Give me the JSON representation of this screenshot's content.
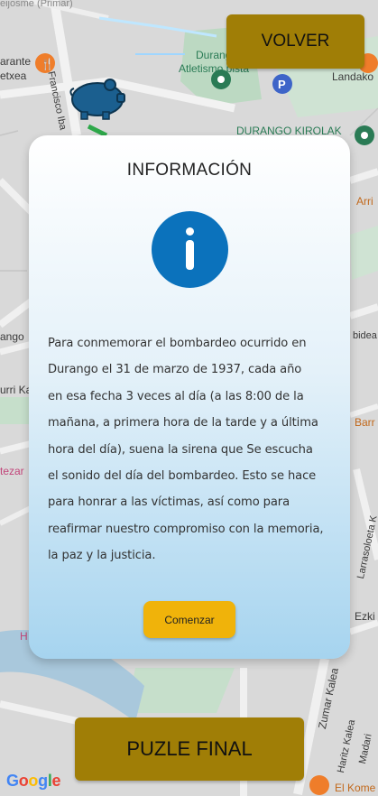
{
  "map": {
    "labels": {
      "arante": "arante",
      "etxea": "etxea",
      "francisco": "Francisco Iba",
      "durangoko": "Durangoko",
      "atletismo": "Atletismo pista",
      "landako_partial": "Landako",
      "kirolak": "DURANGO KIROLAK",
      "arri": "Arri",
      "ango": "ango",
      "urri": "urri Ka",
      "tezar": "tezar",
      "bidea": "bidea",
      "barr": "Barr",
      "larrasoloeta": "Larrasoloeta K",
      "ezki": "Ezki",
      "zumar": "Zumar Kalea",
      "haritz": "Haritz Kalea",
      "madari": "Madari",
      "el_kome": "El Kome",
      "h_left": "H",
      "top_faded": "eijosme (Primar)"
    },
    "parking_letter": "P",
    "colors": {
      "map_bg": "#d8d8d8",
      "park": "#bcd9c2",
      "water": "#9fc2d9",
      "road": "#efefef",
      "accent_green": "#2a7b55",
      "orange_poi": "#ef7d2a",
      "parking_blue": "#3e64c8",
      "piggy": "#1b5f8f"
    }
  },
  "header": {
    "back_label": "VOLVER"
  },
  "dialog": {
    "title": "INFORMACIÓN",
    "icon": "info-icon",
    "lines": [
      "Para conmemorar el bombardeo ocurrido en",
      "Durango el 31 de marzo de 1937, cada año",
      "en esa fecha 3 veces al día (a las 8:00 de la",
      "mañana, a primera hora de la tarde y a última",
      "hora del día), suena la sirena que Se escucha",
      "el sonido del día del bombardeo. Esto se hace",
      "para honrar a las víctimas, así como para",
      "reafirmar nuestro compromiso con la memoria,",
      "la paz y la justicia."
    ],
    "start_label": "Comenzar"
  },
  "footer": {
    "puzzle_label": "PUZLE FINAL",
    "google_letters": [
      "G",
      "o",
      "o",
      "g",
      "l",
      "e"
    ]
  }
}
